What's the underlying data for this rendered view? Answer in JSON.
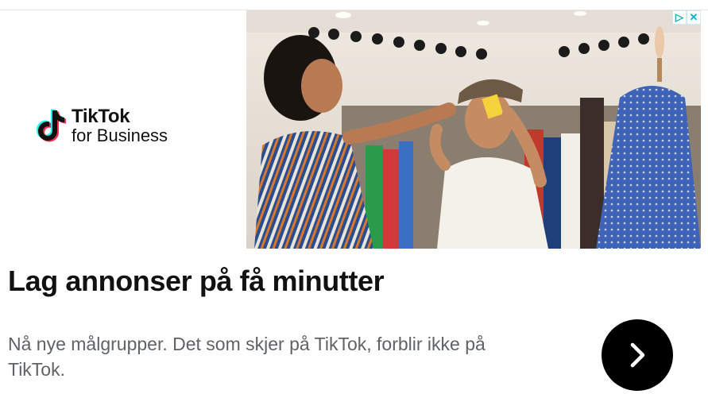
{
  "ad": {
    "logo": {
      "brand": "TikTok",
      "sub": "for Business",
      "icon": "tiktok-note-icon"
    },
    "adchoices": {
      "info_icon": "adchoices-triangle-icon",
      "close_icon": "close-icon",
      "info_glyph": "▷",
      "close_glyph": "✕"
    },
    "headline": "Lag annonser på få minutter",
    "body": "Nå nye målgrupper. Det som skjer på TikTok, forblir ikke på TikTok.",
    "cta_icon": "chevron-right-icon",
    "colors": {
      "tiktok_cyan": "#25f4ee",
      "tiktok_pink": "#fe2c55",
      "adchoices_blue": "#00aecd"
    }
  }
}
